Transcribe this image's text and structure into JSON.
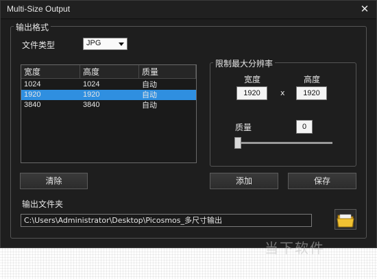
{
  "window": {
    "title": "Multi-Size Output",
    "close_glyph": "✕"
  },
  "output_format": {
    "group_label": "输出格式",
    "file_type_label": "文件类型",
    "file_type_value": "JPG",
    "table": {
      "headers": [
        "宽度",
        "高度",
        "质量"
      ],
      "rows": [
        [
          "1024",
          "1024",
          "自动"
        ],
        [
          "1920",
          "1920",
          "自动"
        ],
        [
          "3840",
          "3840",
          "自动"
        ]
      ],
      "selected_row": 1
    },
    "clear_button": "清除"
  },
  "limit": {
    "group_label": "限制最大分辨率",
    "width_label": "宽度",
    "height_label": "高度",
    "width_value": "1920",
    "height_value": "1920",
    "times": "x",
    "quality_label": "质量",
    "quality_value": "0",
    "quality_level": 0
  },
  "buttons": {
    "add": "添加",
    "save": "保存"
  },
  "output_folder": {
    "label": "输出文件夹",
    "path": "C:\\Users\\Administrator\\Desktop\\Picosmos_多尺寸输出",
    "browse_icon": "folder-icon"
  },
  "watermark": "当下软件"
}
